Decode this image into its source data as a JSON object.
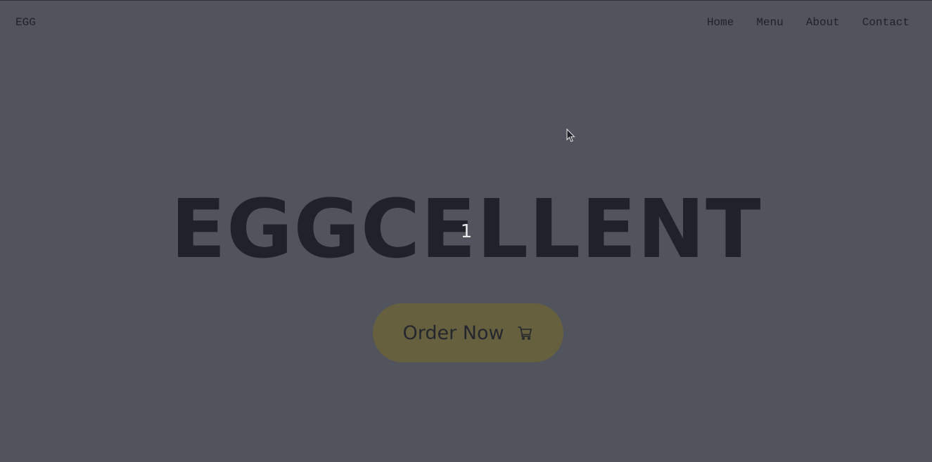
{
  "header": {
    "brand": "EGG",
    "nav": [
      {
        "label": "Home"
      },
      {
        "label": "Menu"
      },
      {
        "label": "About"
      },
      {
        "label": "Contact"
      }
    ]
  },
  "hero": {
    "title": "EGGCELLENT",
    "indicator": "1",
    "cta": {
      "label": "Order Now",
      "icon": "cart-icon"
    }
  },
  "colors": {
    "overlay_background": "#51545c",
    "text_dark": "#1f2228",
    "cta_background": "#67603f",
    "indicator_text": "#e8e8ea"
  },
  "cursor": {
    "icon": "mouse-pointer-icon"
  }
}
